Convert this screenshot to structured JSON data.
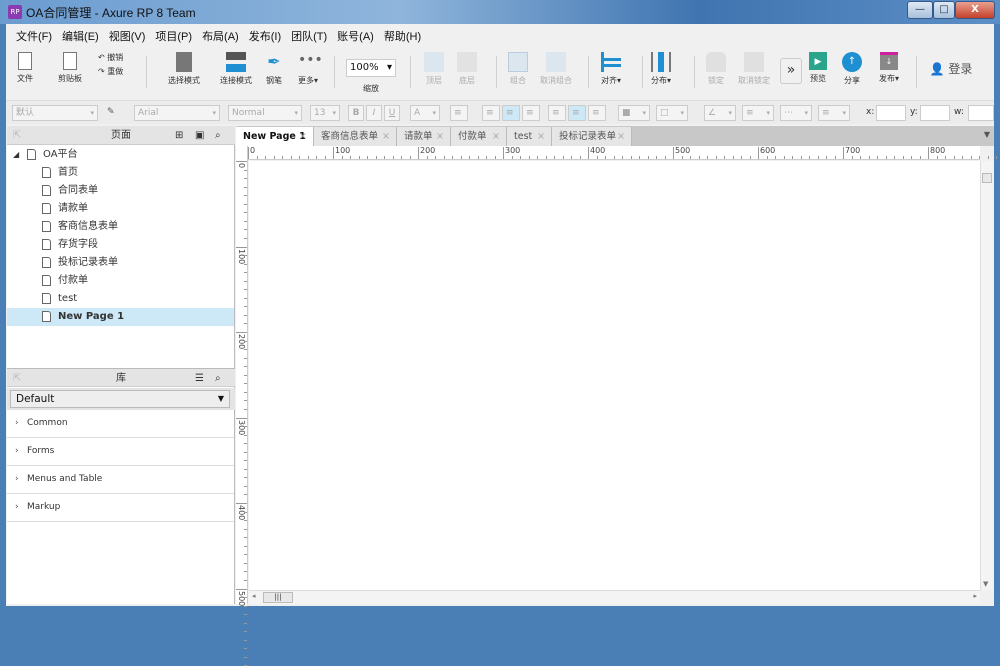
{
  "window": {
    "title": "OA合同管理 - Axure RP 8 Team",
    "app_icon": "RP",
    "minimize": "—",
    "maximize": "□",
    "close": "X"
  },
  "menu": [
    "文件(F)",
    "编辑(E)",
    "视图(V)",
    "项目(P)",
    "布局(A)",
    "发布(I)",
    "团队(T)",
    "账号(A)",
    "帮助(H)"
  ],
  "toolbar": {
    "file": "文件",
    "clipboard": "剪贴板",
    "undo": "撤销",
    "redo": "重做",
    "select_mode": "选择模式",
    "connect_mode": "连接模式",
    "pen": "钢笔",
    "more": "更多▾",
    "zoom_value": "100%",
    "zoom_label": "缩放",
    "top_layer": "顶层",
    "bottom_layer": "底层",
    "group": "组合",
    "ungroup": "取消组合",
    "align": "对齐▾",
    "distribute": "分布▾",
    "lock": "锁定",
    "unlock": "取消锁定",
    "expand": "»",
    "preview": "预览",
    "share": "分享",
    "publish": "发布▾",
    "login": "登录"
  },
  "format": {
    "style": "默认",
    "font": "Arial",
    "weight": "Normal",
    "size": "13",
    "bold": "B",
    "italic": "I",
    "underline": "U",
    "x_label": "x:",
    "y_label": "y:",
    "w_label": "w:"
  },
  "pages_panel": {
    "title": "页面",
    "root": "OA平台",
    "pages": [
      "首页",
      "合同表单",
      "请款单",
      "客商信息表单",
      "存货字段",
      "投标记录表单",
      "付款单",
      "test",
      "New Page 1"
    ],
    "selected": "New Page 1"
  },
  "library_panel": {
    "title": "库",
    "selected_library": "Default",
    "groups": [
      "Common",
      "Forms",
      "Menus and Table",
      "Markup"
    ]
  },
  "tabs": [
    {
      "label": "New Page 1",
      "active": true
    },
    {
      "label": "客商信息表单"
    },
    {
      "label": "请款单"
    },
    {
      "label": "付款单"
    },
    {
      "label": "test"
    },
    {
      "label": "投标记录表单"
    }
  ],
  "ruler": {
    "h": [
      "0",
      "100",
      "200",
      "300",
      "400",
      "500",
      "600",
      "700",
      "800"
    ],
    "v": [
      "0",
      "100",
      "200",
      "300",
      "400",
      "500"
    ]
  },
  "colors": {
    "accent": "#1e8fd0",
    "selection": "#cde8f6",
    "preview": "#2aa58c",
    "publish": "#d020a0"
  }
}
